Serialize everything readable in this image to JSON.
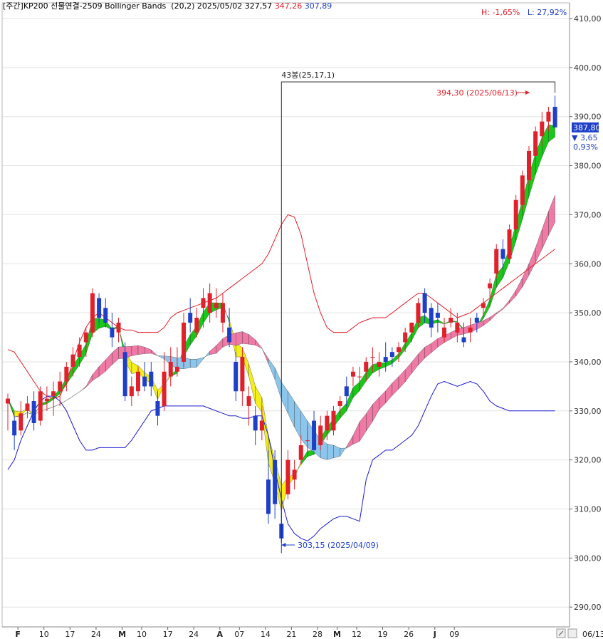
{
  "header": {
    "prefix": "[주간]",
    "symbol": "KP200 선물연결-2509",
    "indicator": "Bollinger Bands",
    "params": "(20,2)",
    "date": "2025/05/02",
    "v1": "327,57",
    "v2": "347,26",
    "v3": "307,89",
    "high_pct": "H: -1,65%",
    "low_pct": "L: 27,92%"
  },
  "colors": {
    "up": "#e0202a",
    "down": "#1e3fc8",
    "band_upper": "#e0202a",
    "band_lower": "#1a1ad0",
    "cloud_green": "#19c819",
    "cloud_yellow": "#f4ee1a",
    "cloud_pink": "#f07aa6",
    "cloud_blue": "#8cc6ec",
    "grid": "#e3e3e3"
  },
  "chart_data": {
    "type": "candlestick",
    "y_axis": {
      "ticks": [
        "410,00",
        "400,00",
        "390,00",
        "380,00",
        "370,00",
        "360,00",
        "350,00",
        "340,00",
        "330,00",
        "320,00",
        "310,00",
        "300,00",
        "290,00"
      ],
      "ylim": [
        284.5,
        413.5
      ]
    },
    "x_axis": {
      "ticks": [
        {
          "label": "F",
          "i": 1
        },
        {
          "label": "10",
          "i": 5
        },
        {
          "label": "17",
          "i": 9
        },
        {
          "label": "24",
          "i": 13
        },
        {
          "label": "M",
          "i": 17
        },
        {
          "label": "10",
          "i": 20
        },
        {
          "label": "17",
          "i": 24
        },
        {
          "label": "24",
          "i": 28
        },
        {
          "label": "A",
          "i": 32
        },
        {
          "label": "07",
          "i": 35
        },
        {
          "label": "14",
          "i": 39
        },
        {
          "label": "21",
          "i": 43
        },
        {
          "label": "28",
          "i": 47
        },
        {
          "label": "M",
          "i": 50
        },
        {
          "label": "12",
          "i": 53
        },
        {
          "label": "19",
          "i": 57
        },
        {
          "label": "26",
          "i": 61
        },
        {
          "label": "J",
          "i": 65
        },
        {
          "label": "09",
          "i": 68
        }
      ],
      "last_date": "06/13"
    },
    "candles": [
      [
        331.5,
        333.5,
        326,
        332.5
      ],
      [
        328,
        329,
        322,
        325
      ],
      [
        326,
        332,
        325,
        329.5
      ],
      [
        330,
        333,
        328.5,
        331.5
      ],
      [
        332,
        334,
        326,
        327.5
      ],
      [
        328,
        335,
        327,
        334
      ],
      [
        332,
        335,
        330,
        332.5
      ],
      [
        333,
        336,
        329,
        334
      ],
      [
        334,
        338,
        331,
        336
      ],
      [
        336,
        340,
        334,
        339
      ],
      [
        339,
        343,
        337,
        341.5
      ],
      [
        341,
        345,
        339,
        343.5
      ],
      [
        344,
        347,
        341,
        346
      ],
      [
        346,
        355,
        345,
        354
      ],
      [
        353,
        354,
        348,
        349
      ],
      [
        351,
        353,
        347,
        348
      ],
      [
        347,
        350,
        343,
        345
      ],
      [
        346,
        349,
        344,
        348
      ],
      [
        342,
        344,
        332,
        333
      ],
      [
        333,
        337,
        331,
        335
      ],
      [
        334,
        339,
        333,
        338
      ],
      [
        337,
        340,
        334,
        335
      ],
      [
        338,
        340,
        333,
        335
      ],
      [
        332,
        334,
        327,
        329
      ],
      [
        331,
        342,
        330,
        338
      ],
      [
        337,
        343,
        335,
        340
      ],
      [
        338,
        343,
        337,
        339
      ],
      [
        340,
        350,
        339,
        348
      ],
      [
        350,
        353,
        346,
        348
      ],
      [
        346,
        351,
        345,
        349
      ],
      [
        351,
        355,
        347,
        353
      ],
      [
        350,
        356,
        348,
        354
      ],
      [
        351,
        355,
        349,
        352
      ],
      [
        348,
        354,
        346,
        352
      ],
      [
        347,
        351,
        343,
        344
      ],
      [
        340,
        342,
        332,
        334
      ],
      [
        334,
        343,
        331,
        341
      ],
      [
        331,
        335,
        327,
        333
      ],
      [
        329,
        331,
        323,
        326
      ],
      [
        326,
        331,
        324,
        328
      ],
      [
        316,
        322,
        307,
        309
      ],
      [
        320,
        322,
        308,
        311
      ],
      [
        307,
        312,
        301,
        304
      ],
      [
        313,
        322,
        312,
        320
      ],
      [
        316,
        320,
        314,
        318
      ],
      [
        320,
        325,
        319,
        323
      ],
      [
        324,
        327,
        321,
        324
      ],
      [
        328,
        330,
        322,
        322
      ],
      [
        323,
        329,
        322,
        327
      ],
      [
        326,
        330,
        324,
        329
      ],
      [
        326,
        331,
        325,
        330
      ],
      [
        331,
        333,
        329,
        332
      ],
      [
        335,
        337,
        331,
        333
      ],
      [
        337,
        339,
        335,
        338
      ],
      [
        337,
        339,
        334,
        337
      ],
      [
        338,
        341,
        336,
        340
      ],
      [
        341,
        343,
        338,
        341
      ],
      [
        339,
        342,
        337,
        340
      ],
      [
        341,
        344,
        338,
        340
      ],
      [
        342,
        343,
        339,
        341
      ],
      [
        342,
        344,
        340,
        343
      ],
      [
        344,
        347,
        342,
        346
      ],
      [
        346,
        348,
        344,
        348
      ],
      [
        348,
        353,
        347,
        352
      ],
      [
        354,
        355,
        348,
        350
      ],
      [
        351,
        352,
        345,
        347
      ],
      [
        350,
        352,
        346,
        349
      ],
      [
        345,
        349,
        344,
        347
      ],
      [
        348,
        351,
        347,
        349
      ],
      [
        346,
        350,
        344,
        348
      ],
      [
        345,
        348,
        343,
        344
      ],
      [
        346,
        349,
        344,
        347
      ],
      [
        349,
        350,
        346,
        348
      ],
      [
        351,
        353,
        349,
        352
      ],
      [
        355,
        357,
        353,
        356
      ],
      [
        358,
        364,
        357,
        363
      ],
      [
        363,
        365,
        359,
        361
      ],
      [
        361,
        368,
        360,
        367
      ],
      [
        367,
        374,
        366,
        373
      ],
      [
        372,
        379,
        371,
        378
      ],
      [
        377,
        384,
        376,
        383
      ],
      [
        382,
        388,
        381,
        387
      ],
      [
        386,
        391,
        384,
        389
      ],
      [
        389,
        392,
        387,
        391
      ],
      [
        392,
        394.3,
        388,
        387.8
      ]
    ],
    "upper_band": [
      342.5,
      342,
      340,
      338,
      336,
      334,
      333,
      332.5,
      333,
      336,
      340,
      344,
      347,
      349,
      350,
      349,
      348,
      347,
      346.5,
      346.5,
      346,
      346,
      346,
      346,
      347,
      349,
      350,
      350.5,
      351,
      351.5,
      352,
      352.5,
      353,
      354,
      355,
      356,
      357,
      358,
      359,
      360,
      362,
      365,
      368,
      370,
      369.5,
      366,
      360,
      354,
      350,
      347,
      346,
      346,
      346,
      347,
      348,
      348.5,
      349,
      349,
      349,
      350,
      351,
      352,
      353,
      354,
      354,
      353,
      352,
      351,
      350,
      349,
      349.5,
      350,
      351,
      352,
      353,
      354,
      355,
      356,
      357,
      358,
      359,
      360,
      361,
      362,
      363
    ],
    "lower_band": [
      318,
      320,
      324,
      327,
      330,
      332,
      333,
      333,
      332,
      330,
      327,
      324,
      322,
      322,
      322.5,
      322.5,
      322.5,
      322.5,
      322.5,
      324,
      326,
      328,
      330,
      330.5,
      331,
      331,
      331,
      331,
      331,
      331,
      331,
      330.5,
      330,
      329.5,
      329,
      329,
      328.5,
      328.5,
      329,
      329,
      325,
      318,
      312,
      307,
      305,
      304,
      303.5,
      304.5,
      306,
      307,
      308,
      308.5,
      308.5,
      308,
      307.5,
      316,
      320,
      321,
      322,
      322,
      323,
      324,
      325,
      327,
      330,
      333,
      335.5,
      336,
      335.5,
      335,
      335.5,
      336,
      335.5,
      334,
      332,
      331,
      330.5,
      330,
      330,
      330,
      330,
      330,
      330,
      330,
      330
    ],
    "annotations": {
      "range_label": "43봉(25,17,1)",
      "high_label": "394,30 (2025/06/13)",
      "low_label": "303,15 (2025/04/09)",
      "last_price": "387,80",
      "last_change": "▼ 3,65",
      "last_change_pct": "0,93%"
    }
  }
}
